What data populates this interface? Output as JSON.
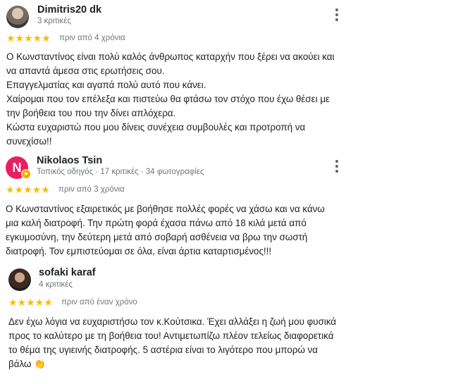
{
  "reviews": [
    {
      "name": "Dimitris20 dk",
      "meta": "3 κριτικές",
      "stars": "★★★★★",
      "rating": 5,
      "date": "πριν από 4 χρόνια",
      "lines": [
        "Ο Κωνσταντίνος είναι πολύ καλός άνθρωπος καταρχήν που ξέρει να ακούει και",
        "να απαντά άμεσα στις ερωτήσεις σου.",
        "Επαγγελματίας και αγαπά πολύ αυτό που κάνει.",
        "Χαίρομαι που τον επέλεξα και πιστεύω θα φτάσω τον στόχο που έχω θέσει με",
        "την βοήθεια του που την δίνει απλόχερα.",
        "Κώστα ευχαριστώ που μου δίνεις συνέχεια συμβουλές και προτροπή να",
        "συνεχίσω!!"
      ]
    },
    {
      "name": "Nikolaos Tsin",
      "avatar_letter": "N",
      "meta": "Τοπικός οδηγός · 17 κριτικές · 34 φωτογραφίες",
      "stars": "★★★★★",
      "rating": 5,
      "date": "πριν από 3 χρόνια",
      "lines": [
        "Ο Κωνσταντίνος εξαιρετικός με βοήθησε πολλές φορές να χάσω και να κάνω",
        "μια καλή διατροφή. Την πρώτη φορά έχασα πάνω από 18 κιλά μετά από",
        "εγκυμοσύνη, την δεύτερη μετά από σοβαρή ασθένεια να βρω την σωστή",
        "διατροφή. Τον εμπιστεύομαι σε όλα, είναι άρτια καταρτισμένος!!!"
      ]
    },
    {
      "name": "sofaki karaf",
      "meta": "4 κριτικές",
      "stars": "★★★★★",
      "rating": 5,
      "date": "πριν από έναν χρόνο",
      "lines": [
        "Δεν έχω λόγια να ευχαριστήσω τον κ.Κούτσικα. Έχει αλλάξει η ζωή μου φυσικά",
        "προς το καλύτερο με τη βοήθεια του! Αντιμετωπίζω πλέον τελείως διαφορετικά",
        "το θέμα της υγιεινής διατροφής. 5 αστέρια είναι το λιγότερο που μπορώ να",
        "βάλω 👏"
      ]
    }
  ],
  "colors": {
    "star": "#fbbc04",
    "avatar_n": "#e91e63",
    "meta_text": "#70757a"
  },
  "icons": [
    "more-vert-icon",
    "local-guide-icon"
  ]
}
